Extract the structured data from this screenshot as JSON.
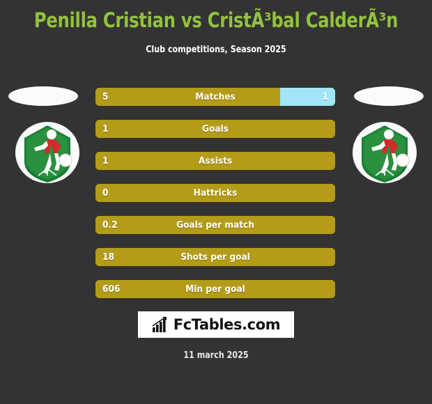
{
  "header": {
    "title": "Penilla Cristian vs CristÃ³bal CalderÃ³n",
    "subtitle": "Club competitions, Season 2025",
    "title_color": "#93C23E",
    "subtitle_color": "#ffffff"
  },
  "colors": {
    "background": "#333333",
    "home_bar": "#B49C19",
    "away_bar": "#A2E5F8",
    "bar_text": "#ffffff"
  },
  "players": {
    "home": {
      "avatar_icon": "soccer-player-shield-icon",
      "club_logo": "club-logo-placeholder"
    },
    "away": {
      "avatar_icon": "soccer-player-shield-icon",
      "club_logo": "club-logo-placeholder"
    }
  },
  "chart_data": {
    "type": "bar",
    "title": "Penilla Cristian vs CristÃ³bal CalderÃ³n",
    "subtitle": "Club competitions, Season 2025",
    "orientation": "horizontal-diverging",
    "legend": [
      "Penilla Cristian",
      "CristÃ³bal CalderÃ³n"
    ],
    "categories": [
      "Matches",
      "Goals",
      "Assists",
      "Hattricks",
      "Goals per match",
      "Shots per goal",
      "Min per goal"
    ],
    "series": [
      {
        "name": "Penilla Cristian",
        "values": [
          5,
          1,
          1,
          0,
          0.2,
          18,
          606
        ]
      },
      {
        "name": "CristÃ³bal CalderÃ³n",
        "values": [
          1,
          null,
          null,
          null,
          null,
          null,
          null
        ]
      }
    ]
  },
  "stats": [
    {
      "label": "Matches",
      "home": "5",
      "away": "1",
      "home_pct": 77,
      "away_pct": 23,
      "has_away": true
    },
    {
      "label": "Goals",
      "home": "1",
      "away": "",
      "home_pct": 100,
      "away_pct": 0,
      "has_away": false
    },
    {
      "label": "Assists",
      "home": "1",
      "away": "",
      "home_pct": 100,
      "away_pct": 0,
      "has_away": false
    },
    {
      "label": "Hattricks",
      "home": "0",
      "away": "",
      "home_pct": 100,
      "away_pct": 0,
      "has_away": false
    },
    {
      "label": "Goals per match",
      "home": "0.2",
      "away": "",
      "home_pct": 100,
      "away_pct": 0,
      "has_away": false
    },
    {
      "label": "Shots per goal",
      "home": "18",
      "away": "",
      "home_pct": 100,
      "away_pct": 0,
      "has_away": false
    },
    {
      "label": "Min per goal",
      "home": "606",
      "away": "",
      "home_pct": 100,
      "away_pct": 0,
      "has_away": false
    }
  ],
  "footer": {
    "brand_text": "FcTables.com",
    "brand_icon": "bar-chart-trend-icon",
    "date": "11 march 2025"
  }
}
